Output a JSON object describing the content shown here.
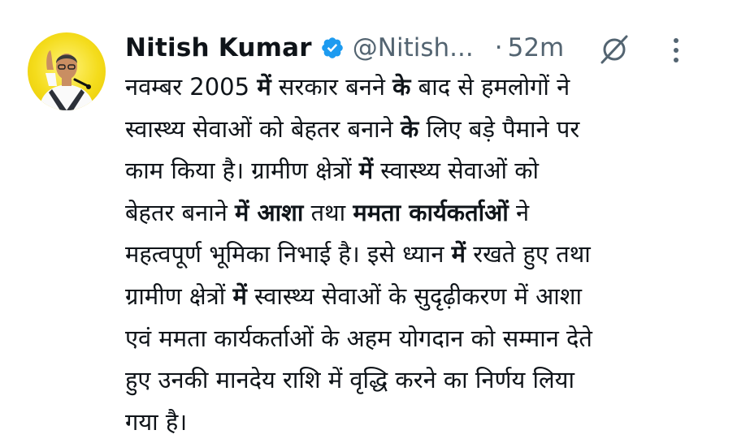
{
  "author": {
    "display_name": "Nitish Kumar",
    "handle": "@Nitish...",
    "separator": "·",
    "timestamp": "52m",
    "avatar_icon": "profile-photo",
    "avatar_bg": "#f4dc1c",
    "verified_color": "#1d9bf0"
  },
  "actions": {
    "grok_icon": "grok-icon",
    "more_icon": "more-vertical-icon"
  },
  "tweet": {
    "lines": [
      [
        {
          "t": "नवम्बर 2005 "
        },
        {
          "t": "में",
          "b": true
        },
        {
          "t": " सरकार बनने "
        },
        {
          "t": "के",
          "b": true
        },
        {
          "t": " बाद से हमलोगों ने"
        }
      ],
      [
        {
          "t": "स्वास्थ्य सेवाओं को बेहतर बनाने "
        },
        {
          "t": "के",
          "b": true
        },
        {
          "t": " लिए बड़े पैमाने पर"
        }
      ],
      [
        {
          "t": "काम किया है। ग्रामीण क्षेत्रों "
        },
        {
          "t": "में",
          "b": true
        },
        {
          "t": " स्वास्थ्य सेवाओं को"
        }
      ],
      [
        {
          "t": "बेहतर बनाने "
        },
        {
          "t": "में आशा",
          "b": true
        },
        {
          "t": " तथा "
        },
        {
          "t": "ममता कार्यकर्ताओं",
          "b": true
        },
        {
          "t": " ने"
        }
      ],
      [
        {
          "t": "महत्वपूर्ण भूमिका निभाई है। इसे ध्यान "
        },
        {
          "t": "में",
          "b": true
        },
        {
          "t": " रखते हुए तथा"
        }
      ],
      [
        {
          "t": "ग्रामीण क्षेत्रों "
        },
        {
          "t": "में",
          "b": true
        },
        {
          "t": " स्वास्थ्य सेवाओं के सुदृढ़ीकरण में आशा"
        }
      ],
      [
        {
          "t": "एवं ममता कार्यकर्ताओं के अहम योगदान को सम्मान देते"
        }
      ],
      [
        {
          "t": "हुए उनकी मानदेय राशि में वृद्धि करने का निर्णय लिया"
        }
      ],
      [
        {
          "t": "गया है।"
        }
      ]
    ]
  }
}
